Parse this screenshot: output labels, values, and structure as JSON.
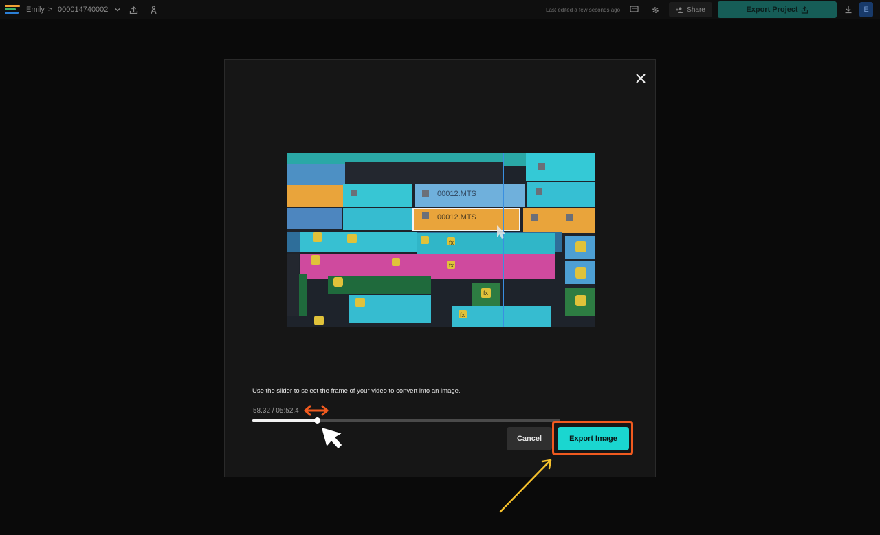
{
  "topbar": {
    "user_name": "Emily",
    "separator": ">",
    "project_id": "000014740002",
    "last_edited": "Last edited a few seconds ago",
    "share_label": "Share",
    "export_project_label": "Export Project",
    "avatar_initial": "E",
    "logo_colors": [
      "#f2a134",
      "#3bb36a",
      "#2b7fd6"
    ]
  },
  "modal": {
    "instructions": "Use the slider to select the frame of your video to convert into an image.",
    "time_readout": "58.32 / 05:52.4",
    "slider_progress": 0.209,
    "cancel_label": "Cancel",
    "export_image_label": "Export Image",
    "preview_clip_labels": [
      "00012.MTS",
      "00012.MTS"
    ],
    "preview_fx_label": "fx"
  },
  "colors": {
    "accent": "#1ad6d0",
    "highlight": "#f05a1f",
    "pointer_arrow": "#f5c02c"
  }
}
